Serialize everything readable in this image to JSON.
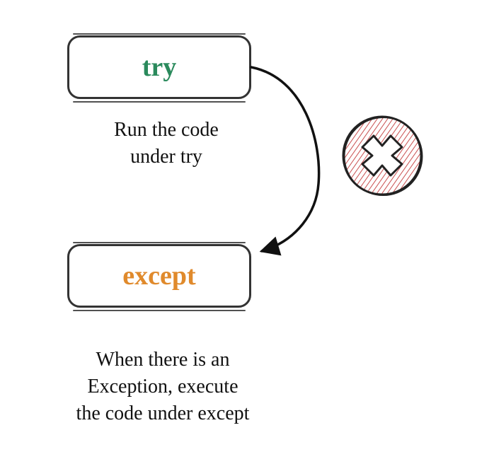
{
  "diagram": {
    "boxes": {
      "try": {
        "label": "try"
      },
      "except": {
        "label": "except"
      }
    },
    "captions": {
      "try_desc_line1": "Run the code",
      "try_desc_line2": "under try",
      "except_desc_line1": "When there is an",
      "except_desc_line2": "Exception, execute",
      "except_desc_line3": "the code under except"
    },
    "icons": {
      "error": "cross-icon"
    },
    "colors": {
      "try": "#2a8a5c",
      "except": "#e08a2c",
      "error_fill": "#c94f4f",
      "stroke": "#333333"
    }
  }
}
